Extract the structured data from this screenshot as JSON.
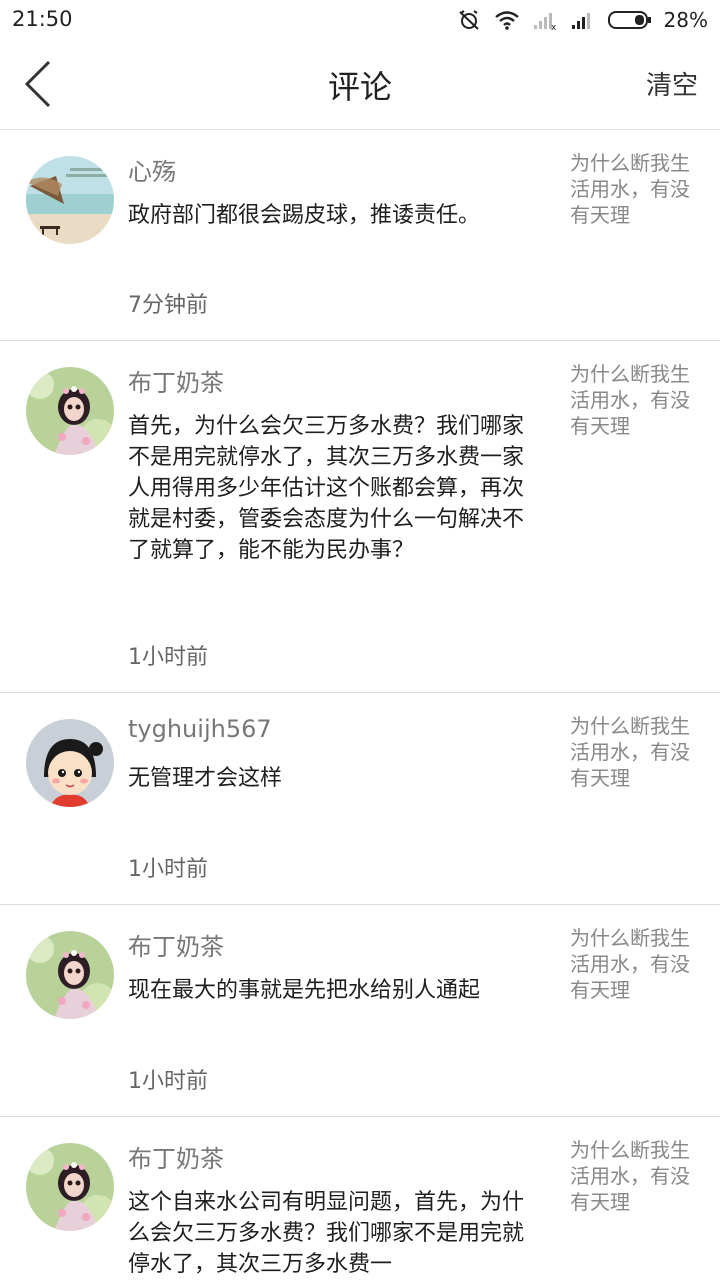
{
  "status_bar": {
    "time": "21:50",
    "battery": "28%",
    "icons": [
      "alarm-off-icon",
      "wifi-icon",
      "signal-x-icon",
      "signal-icon",
      "battery-icon"
    ]
  },
  "header": {
    "title": "评论",
    "clear_label": "清空",
    "back_icon": "chevron-left-icon"
  },
  "comments": [
    {
      "username": "心殇",
      "content": "政府部门都很会踢皮球，推诿责任。",
      "time": "7分钟前",
      "article": "为什么断我生活用水，有没有天理",
      "avatar": "landscape-bench-avatar"
    },
    {
      "username": "布丁奶茶",
      "content": "首先，为什么会欠三万多水费？我们哪家不是用完就停水了，其次三万多水费一家人用得用多少年估计这个账都会算，再次就是村委，管委会态度为什么一句解决不了就算了，能不能为民办事？",
      "time": "1小时前",
      "article": "为什么断我生活用水，有没有天理",
      "avatar": "doll-avatar"
    },
    {
      "username": "tyghuijh567",
      "content": "无管理才会这样",
      "time": "1小时前",
      "article": "为什么断我生活用水，有没有天理",
      "avatar": "cartoon-girl-avatar"
    },
    {
      "username": "布丁奶茶",
      "content": "现在最大的事就是先把水给别人通起",
      "time": "1小时前",
      "article": "为什么断我生活用水，有没有天理",
      "avatar": "doll-avatar"
    },
    {
      "username": "布丁奶茶",
      "content": "这个自来水公司有明显问题，首先，为什么会欠三万多水费？我们哪家不是用完就停水了，其次三万多水费一",
      "time": "",
      "article": "为什么断我生活用水，有没有天理",
      "avatar": "doll-avatar"
    }
  ]
}
